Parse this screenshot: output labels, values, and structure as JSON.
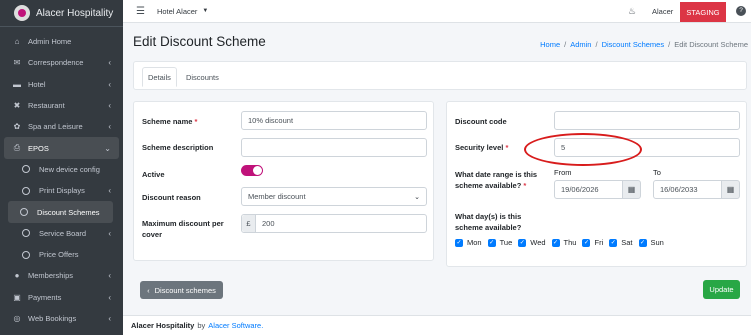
{
  "brand": {
    "name": "Alacer Hospitality"
  },
  "sidebar": {
    "items": [
      {
        "label": "Admin Home",
        "icon": "home-icon"
      },
      {
        "label": "Correspondence",
        "icon": "envelope-icon"
      },
      {
        "label": "Hotel",
        "icon": "bed-icon"
      },
      {
        "label": "Restaurant",
        "icon": "utensils-icon"
      },
      {
        "label": "Spa and Leisure",
        "icon": "spa-icon"
      },
      {
        "label": "EPOS",
        "icon": "printer-icon"
      },
      {
        "label": "New device config"
      },
      {
        "label": "Print Displays"
      },
      {
        "label": "Discount Schemes"
      },
      {
        "label": "Service Board"
      },
      {
        "label": "Price Offers"
      },
      {
        "label": "Memberships",
        "icon": "users-icon"
      },
      {
        "label": "Payments",
        "icon": "credit-card-icon"
      },
      {
        "label": "Web Bookings",
        "icon": "globe-icon"
      }
    ]
  },
  "topbar": {
    "hotel": "Hotel Alacer",
    "user": "Alacer",
    "environment": "STAGING",
    "colors": {
      "staging": "#dc3545"
    }
  },
  "header": {
    "title": "Edit Discount Scheme",
    "breadcrumb": [
      "Home",
      "Admin",
      "Discount Schemes",
      "Edit Discount Scheme"
    ]
  },
  "tabs": [
    "Details",
    "Discounts"
  ],
  "form": {
    "scheme_name_label": "Scheme name",
    "scheme_name_value": "10% discount",
    "scheme_description_label": "Scheme description",
    "scheme_description_value": "",
    "active_label": "Active",
    "discount_reason_label": "Discount reason",
    "discount_reason_value": "Member discount",
    "max_discount_label_1": "Maximum discount per",
    "max_discount_label_2": "cover",
    "max_discount_prefix": "£",
    "max_discount_value": "200",
    "discount_code_label": "Discount code",
    "discount_code_value": "",
    "security_level_label": "Security level",
    "security_level_value": "5",
    "date_range_label_1": "What date range is this",
    "date_range_label_2": "scheme available?",
    "from_label": "From",
    "from_value": "19/06/2026",
    "to_label": "To",
    "to_value": "16/06/2033",
    "days_label_1": "What day(s) is this",
    "days_label_2": "scheme available?",
    "days": [
      "Mon",
      "Tue",
      "Wed",
      "Thu",
      "Fri",
      "Sat",
      "Sun"
    ],
    "required_marker": "*"
  },
  "buttons": {
    "back": "Discount schemes",
    "update": "Update"
  },
  "footer": {
    "company": "Alacer Hospitality",
    "by": "by",
    "software": "Alacer Software."
  },
  "colors": {
    "accent": "#c0127a",
    "primary": "#007bff",
    "success": "#28a745",
    "sidebar": "#343a40"
  }
}
